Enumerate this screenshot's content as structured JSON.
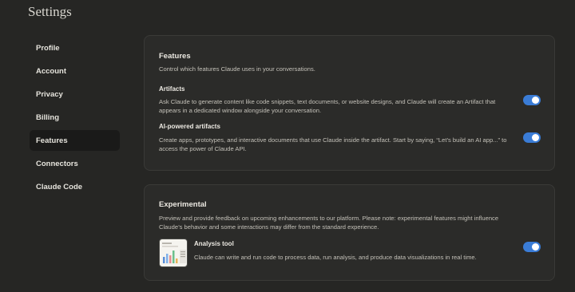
{
  "page": {
    "title": "Settings"
  },
  "sidebar": {
    "items": [
      {
        "label": "Profile"
      },
      {
        "label": "Account"
      },
      {
        "label": "Privacy"
      },
      {
        "label": "Billing"
      },
      {
        "label": "Features",
        "active": true
      },
      {
        "label": "Connectors"
      },
      {
        "label": "Claude Code"
      }
    ]
  },
  "features": {
    "title": "Features",
    "description": "Control which features Claude uses in your conversations.",
    "artifacts": {
      "title": "Artifacts",
      "description": "Ask Claude to generate content like code snippets, text documents, or website designs, and Claude will create an Artifact that appears in a dedicated window alongside your conversation.",
      "enabled": true
    },
    "ai_artifacts": {
      "title": "AI-powered artifacts",
      "description": "Create apps, prototypes, and interactive documents that use Claude inside the artifact. Start by saying, “Let’s build an AI app...” to access the power of Claude API.",
      "enabled": true
    }
  },
  "experimental": {
    "title": "Experimental",
    "description": "Preview and provide feedback on upcoming enhancements to our platform. Please note: experimental features might influence Claude’s behavior and some interactions may differ from the standard experience.",
    "analysis_tool": {
      "title": "Analysis tool",
      "description": "Claude can write and run code to process data, run analysis, and produce data visualizations in real time.",
      "enabled": true
    }
  },
  "colors": {
    "accent": "#3a7cd6",
    "background": "#262624",
    "card": "#2b2b29"
  }
}
